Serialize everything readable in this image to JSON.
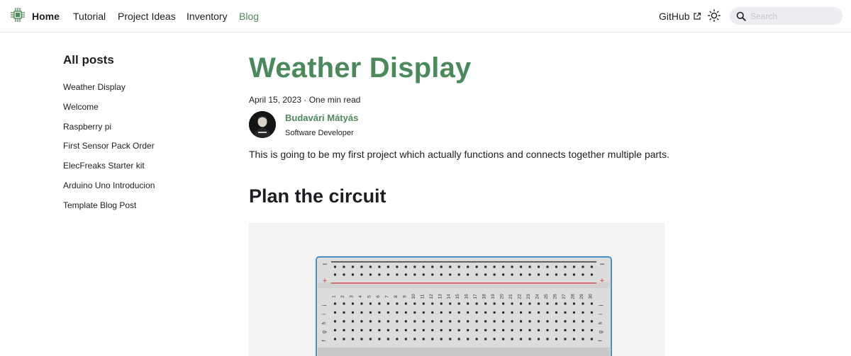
{
  "navbar": {
    "brand": "Home",
    "links": [
      "Tutorial",
      "Project Ideas",
      "Inventory",
      "Blog"
    ],
    "active_link": "Blog",
    "github": "GitHub",
    "search_placeholder": "Search",
    "accent_color": "#4a8a5a"
  },
  "sidebar": {
    "title": "All posts",
    "items": [
      "Weather Display",
      "Welcome",
      "Raspberry pi",
      "First Sensor Pack Order",
      "ElecFreaks Starter kit",
      "Arduino Uno Introducion",
      "Template Blog Post"
    ]
  },
  "post": {
    "title": "Weather Display",
    "meta": "April 15, 2023 · One min read",
    "author_name": "Budavári Mátyás",
    "author_title": "Software Developer",
    "intro": "This is going to be my first project which actually functions and connects together multiple parts.",
    "section_heading": "Plan the circuit"
  },
  "breadboard": {
    "rail_minus": "–",
    "rail_plus": "+",
    "row_letters": [
      "j",
      "i",
      "h",
      "g",
      "f"
    ],
    "column_numbers": [
      "1",
      "2",
      "3",
      "4",
      "5",
      "6",
      "7",
      "8",
      "9",
      "10",
      "11",
      "12",
      "13",
      "14",
      "15",
      "16",
      "17",
      "18",
      "19",
      "20",
      "21",
      "22",
      "23",
      "24",
      "25",
      "26",
      "27",
      "28",
      "29",
      "30"
    ]
  }
}
